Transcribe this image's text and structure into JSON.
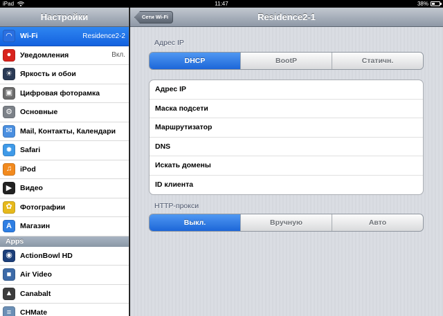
{
  "status_bar": {
    "device": "iPad",
    "time": "11:47",
    "battery": "38%",
    "battery_level": 0.38
  },
  "left_panel": {
    "title": "Настройки",
    "items": [
      {
        "label": "Wi-Fi",
        "value": "Residence2-2",
        "icon": "wifi-icon",
        "color": "#2a6fe0",
        "selected": true
      },
      {
        "label": "Уведомления",
        "value": "Вкл.",
        "icon": "notifications-icon",
        "color": "#d8231d"
      },
      {
        "label": "Яркость и обои",
        "value": "",
        "icon": "brightness-icon",
        "color": "#2a3a55"
      },
      {
        "label": "Цифровая фоторамка",
        "value": "",
        "icon": "picture-frame-icon",
        "color": "#6b6b6b"
      },
      {
        "label": "Основные",
        "value": "",
        "icon": "gear-icon",
        "color": "#7c8188"
      },
      {
        "label": "Mail, Контакты, Календари",
        "value": "",
        "icon": "mail-icon",
        "color": "#4a8fe0"
      },
      {
        "label": "Safari",
        "value": "",
        "icon": "safari-compass-icon",
        "color": "#3f9ae8"
      },
      {
        "label": "iPod",
        "value": "",
        "icon": "ipod-icon",
        "color": "#f28a1e"
      },
      {
        "label": "Видео",
        "value": "",
        "icon": "video-clapper-icon",
        "color": "#222222"
      },
      {
        "label": "Фотографии",
        "value": "",
        "icon": "sunflower-icon",
        "color": "#e6b91c"
      },
      {
        "label": "Магазин",
        "value": "",
        "icon": "app-store-icon",
        "color": "#2e7ee3"
      }
    ],
    "apps_section": "Apps",
    "apps": [
      {
        "label": "ActionBowl HD",
        "icon": "bowling-app-icon",
        "color": "#1c3f7a"
      },
      {
        "label": "Air Video",
        "icon": "air-video-app-icon",
        "color": "#3c6aa8"
      },
      {
        "label": "Canabalt",
        "icon": "canabalt-app-icon",
        "color": "#3d3d3d"
      },
      {
        "label": "CHMate",
        "icon": "chmate-app-icon",
        "color": "#6b8fb5"
      }
    ]
  },
  "right_panel": {
    "back_button": "Сети Wi-Fi",
    "title": "Residence2-1",
    "ip_group_title": "Адрес IP",
    "ip_modes": [
      {
        "label": "DHCP",
        "active": true
      },
      {
        "label": "BootP",
        "active": false
      },
      {
        "label": "Статичн.",
        "active": false
      }
    ],
    "fields": [
      {
        "label": "Адрес IP"
      },
      {
        "label": "Маска подсети"
      },
      {
        "label": "Маршрутизатор"
      },
      {
        "label": "DNS"
      },
      {
        "label": "Искать домены"
      },
      {
        "label": "ID клиента"
      }
    ],
    "proxy_group_title": "HTTP-прокси",
    "proxy_modes": [
      {
        "label": "Выкл.",
        "active": true
      },
      {
        "label": "Вручную",
        "active": false
      },
      {
        "label": "Авто",
        "active": false
      }
    ]
  }
}
